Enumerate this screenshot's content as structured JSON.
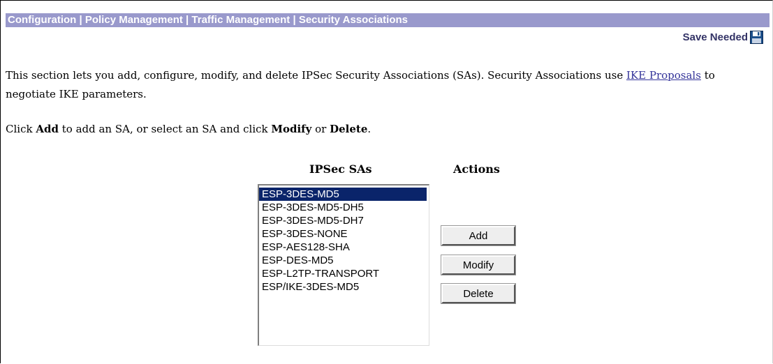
{
  "header": {
    "breadcrumb": "Configuration | Policy Management | Traffic Management | Security Associations",
    "save_needed": "Save Needed"
  },
  "description": {
    "before_link": "This section lets you add, configure, modify, and delete IPSec Security Associations (SAs). Security Associations use ",
    "link_text": "IKE Proposals",
    "after_link": " to negotiate IKE parameters."
  },
  "instructions": {
    "part1": "Click ",
    "add": "Add",
    "part2": " to add an SA, or select an SA and click ",
    "modify": "Modify",
    "part3": " or ",
    "delete": "Delete",
    "part4": "."
  },
  "sa_list": {
    "heading": "IPSec SAs",
    "selected_index": 0,
    "items": [
      "ESP-3DES-MD5",
      "ESP-3DES-MD5-DH5",
      "ESP-3DES-MD5-DH7",
      "ESP-3DES-NONE",
      "ESP-AES128-SHA",
      "ESP-DES-MD5",
      "ESP-L2TP-TRANSPORT",
      "ESP/IKE-3DES-MD5"
    ]
  },
  "actions": {
    "heading": "Actions",
    "add_label": "Add",
    "modify_label": "Modify",
    "delete_label": "Delete"
  },
  "icons": {
    "save": "floppy-disk-icon"
  },
  "colors": {
    "header_bar": "#9999cc",
    "header_text": "#ffffff",
    "selection": "#0a246a",
    "link": "#333399"
  }
}
